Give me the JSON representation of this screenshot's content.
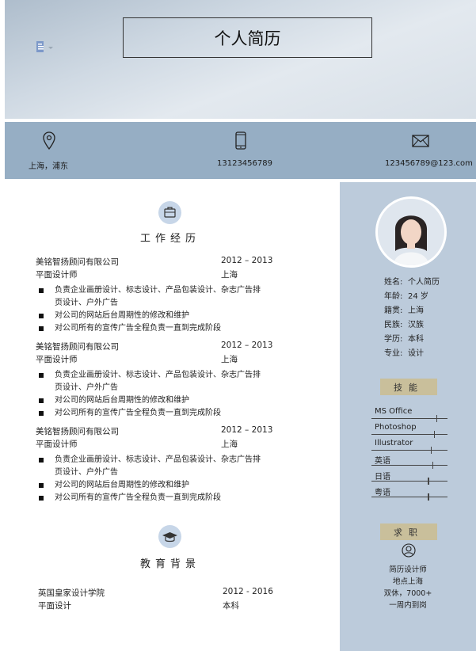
{
  "title": "个人简历",
  "contact": [
    {
      "icon": "location-pin-icon",
      "text": "上海，浦东"
    },
    {
      "icon": "phone-icon",
      "text": "13123456789"
    },
    {
      "icon": "mail-icon",
      "text": "123456789@123.com"
    }
  ],
  "work": {
    "heading": "工作经历",
    "entries": [
      {
        "company": "美铭智扬顾问有限公司",
        "period": "2012 – 2013",
        "role": "平面设计师",
        "city": "上海",
        "duties": [
          "负责企业画册设计、标志设计、产品包装设计、杂志广告排页设计、户外广告",
          "对公司的网站后台周期性的修改和维护",
          "对公司所有的宣传广告全程负责一直到完成阶段"
        ]
      },
      {
        "company": "美铭智扬顾问有限公司",
        "period": "2012 – 2013",
        "role": "平面设计师",
        "city": "上海",
        "duties": [
          "负责企业画册设计、标志设计、产品包装设计、杂志广告排页设计、户外广告",
          "对公司的网站后台周期性的修改和维护",
          "对公司所有的宣传广告全程负责一直到完成阶段"
        ]
      },
      {
        "company": "美铭智扬顾问有限公司",
        "period": "2012 – 2013",
        "role": "平面设计师",
        "city": "上海",
        "duties": [
          "负责企业画册设计、标志设计、产品包装设计、杂志广告排页设计、户外广告",
          "对公司的网站后台周期性的修改和维护",
          "对公司所有的宣传广告全程负责一直到完成阶段"
        ]
      }
    ]
  },
  "education": {
    "heading": "教育背景",
    "school": "英国皇家设计学院",
    "period": "2012 - 2016",
    "major": "平面设计",
    "degree": "本科"
  },
  "profile": [
    {
      "key": "姓名:",
      "value": "个人简历"
    },
    {
      "key": "年龄:",
      "value": "24 岁"
    },
    {
      "key": "籍贯:",
      "value": "上海"
    },
    {
      "key": "民族:",
      "value": "汉族"
    },
    {
      "key": "学历:",
      "value": "本科"
    },
    {
      "key": "专业:",
      "value": "设计"
    }
  ],
  "skills_heading": "技能",
  "skills": [
    {
      "name": "MS Office",
      "level": 0.85
    },
    {
      "name": "Photoshop",
      "level": 0.82
    },
    {
      "name": "Illustrator",
      "level": 0.78
    },
    {
      "name": "英语",
      "level": 0.8
    },
    {
      "name": "日语",
      "level": 0.74
    },
    {
      "name": "粤语",
      "level": 0.74
    }
  ],
  "job_heading": "求职",
  "job": [
    "简历设计师",
    "地点上海",
    "双休，7000+",
    "一周内到岗"
  ],
  "colors": {
    "contact_band": "#96aec4",
    "sidebar": "#bccbdb",
    "tag": "#c9bf9b",
    "icon_circle": "#c7d6e8"
  }
}
